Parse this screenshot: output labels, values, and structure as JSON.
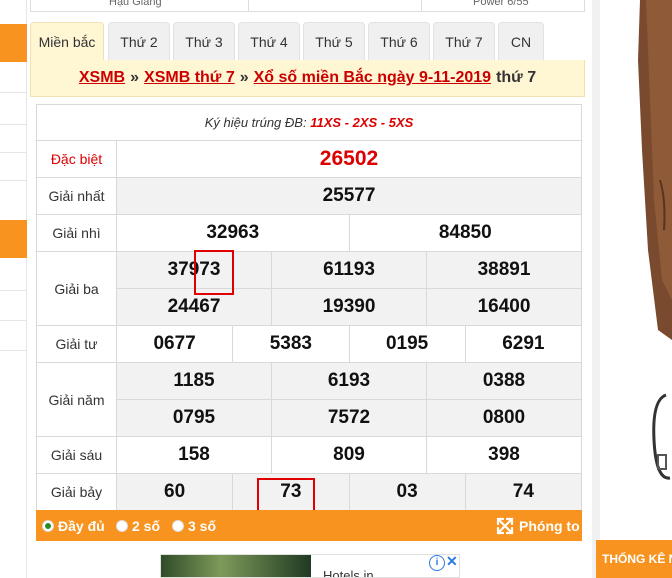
{
  "top_strip": {
    "left_text": "Hậu Giang",
    "right_text": "Power 6/55"
  },
  "tabs": [
    {
      "label": "Miền bắc",
      "active": true
    },
    {
      "label": "Thứ 2"
    },
    {
      "label": "Thứ 3"
    },
    {
      "label": "Thứ 4"
    },
    {
      "label": "Thứ 5"
    },
    {
      "label": "Thứ 6"
    },
    {
      "label": "Thứ 7"
    },
    {
      "label": "CN"
    }
  ],
  "breadcrumb": {
    "link1": "XSMB",
    "sep": "»",
    "link2": "XSMB thứ 7",
    "link3": "Xổ số miền Bắc ngày 9-11-2019",
    "suffix": "thứ 7"
  },
  "results": {
    "code_label": "Ký hiệu trúng ĐB:",
    "codes": "11XS - 2XS - 5XS",
    "dac_biet": {
      "label": "Đặc biệt",
      "values": [
        "26502"
      ]
    },
    "giai_nhat": {
      "label": "Giải nhất",
      "values": [
        "25577"
      ]
    },
    "giai_nhi": {
      "label": "Giải nhì",
      "values": [
        "32963",
        "84850"
      ]
    },
    "giai_ba": {
      "label": "Giải ba",
      "values": [
        "37973",
        "61193",
        "38891",
        "24467",
        "19390",
        "16400"
      ]
    },
    "giai_tu": {
      "label": "Giải tư",
      "values": [
        "0677",
        "5383",
        "0195",
        "6291"
      ]
    },
    "giai_nam": {
      "label": "Giải năm",
      "values": [
        "1185",
        "6193",
        "0388",
        "0795",
        "7572",
        "0800"
      ]
    },
    "giai_sau": {
      "label": "Giải sáu",
      "values": [
        "158",
        "809",
        "398"
      ]
    },
    "giai_bay": {
      "label": "Giải bảy",
      "values": [
        "60",
        "73",
        "03",
        "74"
      ]
    }
  },
  "options": {
    "full": "Đầy đủ",
    "two": "2 số",
    "three": "3 số",
    "zoom": "Phóng to",
    "selected": "full"
  },
  "ad": {
    "text": "Hotels in",
    "info": "i",
    "close": "✕"
  },
  "right_banner": {
    "text": "THỐNG KÊ NHANH"
  },
  "colors": {
    "accent": "#f7931e",
    "link_red": "#c00000",
    "highlight": "#e00000"
  }
}
